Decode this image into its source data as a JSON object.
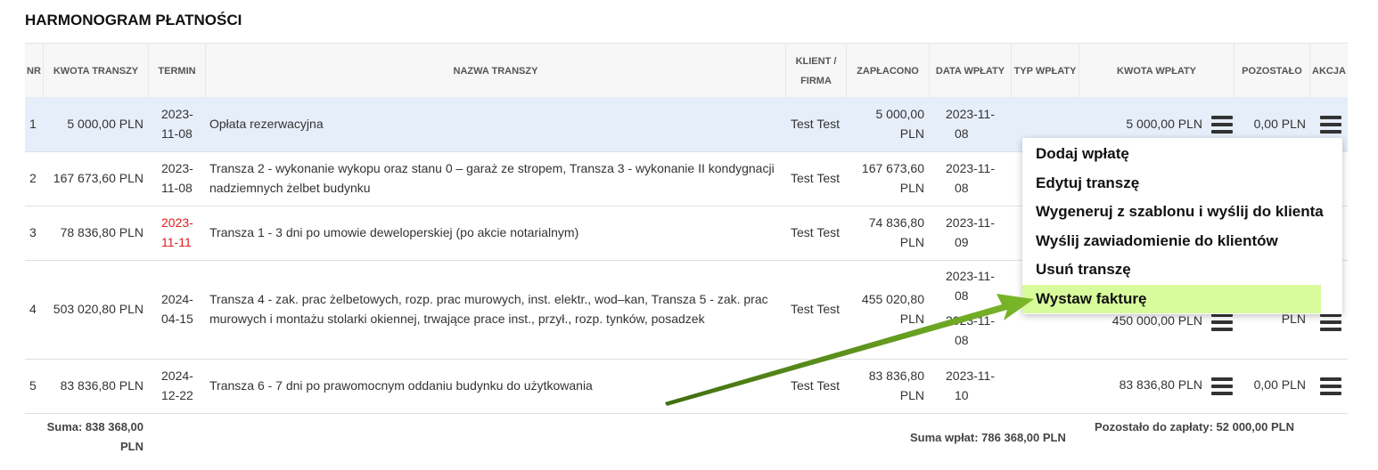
{
  "title": "HARMONOGRAM PŁATNOŚCI",
  "columns": {
    "nr": "NR",
    "kwota_transzy": "KWOTA TRANSZY",
    "termin": "TERMIN",
    "nazwa": "NAZWA TRANSZY",
    "klient_1": "KLIENT /",
    "klient_2": "FIRMA",
    "zaplacono": "ZAPŁACONO",
    "data_wplaty": "DATA WPŁATY",
    "typ_wplaty": "TYP WPŁATY",
    "kwota_wplaty": "KWOTA WPŁATY",
    "pozostalo": "POZOSTAŁO",
    "akcja": "AKCJA"
  },
  "rows": [
    {
      "nr": "1",
      "kwota": "5 000,00 PLN",
      "termin_1": "2023-",
      "termin_2": "11-08",
      "nazwa_1": "Opłata rezerwacyjna",
      "nazwa_2": "",
      "klient": "Test Test",
      "zapl_1": "5 000,00",
      "zapl_2": "PLN",
      "data_1": "2023-11-",
      "data_2": "08",
      "kwota_wplaty": "5 000,00 PLN",
      "pozostalo": "0,00 PLN"
    },
    {
      "nr": "2",
      "kwota": "167 673,60 PLN",
      "termin_1": "2023-",
      "termin_2": "11-08",
      "nazwa_1": "Transza 2 - wykonanie wykopu oraz stanu 0 – garaż ze stropem, Transza 3 - wykonanie II kondygnacji",
      "nazwa_2": "nadziemnych żelbet budynku",
      "klient": "Test Test",
      "zapl_1": "167 673,60",
      "zapl_2": "PLN",
      "data_1": "2023-11-",
      "data_2": "08"
    },
    {
      "nr": "3",
      "kwota": "78 836,80 PLN",
      "termin_1": "2023-",
      "termin_2": "11-11",
      "nazwa_1": "Transza 1 - 3 dni po umowie deweloperskiej (po akcie notarialnym)",
      "nazwa_2": "",
      "klient": "Test Test",
      "zapl_1": "74 836,80",
      "zapl_2": "PLN",
      "data_1": "2023-11-",
      "data_2": "09"
    },
    {
      "nr": "4",
      "kwota": "503 020,80 PLN",
      "termin_1": "2024-",
      "termin_2": "04-15",
      "nazwa_1": "Transza 4 - zak. prac żelbetowych, rozp. prac murowych, inst. elektr., wod–kan, Transza 5 - zak. prac",
      "nazwa_2": "murowych i montażu stolarki okiennej, trwające prace inst., przył., rozp. tynków, posadzek",
      "klient": "Test Test",
      "zapl_1": "455 020,80",
      "zapl_2": "PLN",
      "data_1": "2023-11-",
      "data_2": "08",
      "data_3": "2023-11-",
      "data_4": "08",
      "kwota_wplaty": "450 000,00 PLN",
      "pozostalo": "PLN"
    },
    {
      "nr": "5",
      "kwota": "83 836,80 PLN",
      "termin_1": "2024-",
      "termin_2": "12-22",
      "nazwa_1": "Transza 6 - 7 dni po prawomocnym oddaniu budynku do użytkowania",
      "nazwa_2": "",
      "klient": "Test Test",
      "zapl_1": "83 836,80",
      "zapl_2": "PLN",
      "data_1": "2023-11-",
      "data_2": "10",
      "kwota_wplaty": "83 836,80 PLN",
      "pozostalo": "0,00 PLN"
    }
  ],
  "footer": {
    "suma_1": "Suma: 838 368,00",
    "suma_2": "PLN",
    "suma_wplat": "Suma wpłat: 786 368,00 PLN",
    "pozostalo": "Pozostało do zapłaty: 52 000,00 PLN"
  },
  "menu": {
    "items": [
      "Dodaj wpłatę",
      "Edytuj transzę",
      "Wygeneruj z szablonu i wyślij do klienta",
      "Wyślij zawiadomienie do klientów",
      "Usuń transzę",
      "Wystaw fakturę"
    ]
  },
  "colors": {
    "highlight_row": "#e6eefa",
    "menu_active": "#d8fb9c",
    "overdue": "#e01c1c",
    "arrow": "#5a8f1a"
  }
}
